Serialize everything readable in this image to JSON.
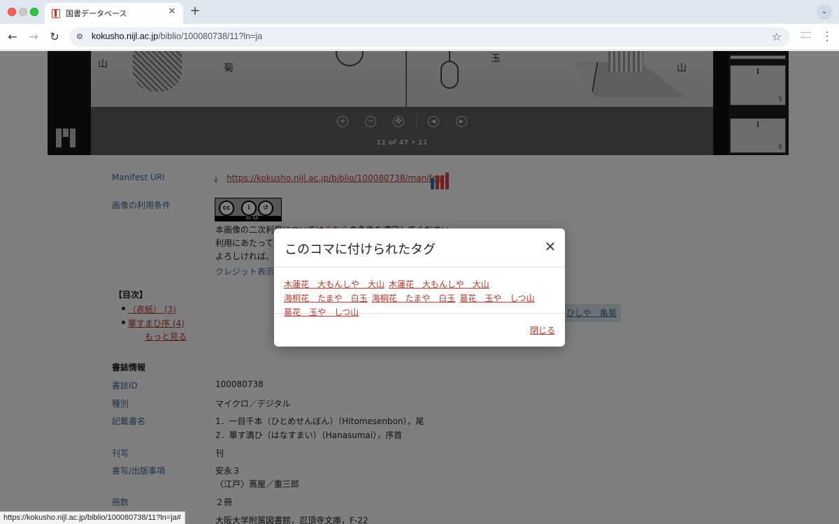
{
  "browser": {
    "tab_title": "国書データベース",
    "tab_close": "✕",
    "new_tab": "+",
    "url_host": "kokusho.nijl.ac.jp",
    "url_path": "/biblio/100080738/11?ln=ja",
    "status_url": "https://kokusho.nijl.ac.jp/biblio/100080738/11?ln=ja#"
  },
  "viewer": {
    "page_indicator": "11 of 47 • 11",
    "controls": [
      "zoom-in",
      "zoom-out",
      "reset",
      "previous",
      "next"
    ],
    "thumbnails": [
      "5",
      "6"
    ]
  },
  "metadata": {
    "manifest_label": "Manifest URI",
    "manifest_url": "https://kokusho.nijl.ac.jp/biblio/100080738/manifest",
    "license_label": "画像の利用条件",
    "license_badge": "BY SA",
    "license_line1_pre": "本画像の二次利用については",
    "license_line1_link": "こちら",
    "license_line1_post": "の条件を遵守してください。",
    "license_line2": "利用にあたって",
    "license_line3": "よろしければ、",
    "credit_link": "クレジット表示",
    "toc_title": "【目次】",
    "toc_items": [
      "（表紙） (3)",
      "華すまひ序 (4)"
    ],
    "toc_more": "もっと見る",
    "toc_hidden_item": "ひしや　亀菊",
    "bib_section": "書誌情報",
    "fields": [
      {
        "label": "書誌ID",
        "value": "100080738"
      },
      {
        "label": "種別",
        "value": "マイクロ／デジタル"
      },
      {
        "label": "記載書名",
        "value": "1．一目千本（ひとめせんぼん）（Hitomesenbon），尾",
        "value2": "2．華す満ひ（はなすまい）（Hanasumai），序首"
      },
      {
        "label": "刊写",
        "value": "刊"
      },
      {
        "label": "書写/出版事項",
        "value": "安永３",
        "value2": "〈江戸〉蔦屋／重三郎"
      },
      {
        "label": "冊数",
        "value": "２冊"
      },
      {
        "label": "",
        "value": "大阪大学附属図書館，忍頂寺文庫，F-22"
      }
    ]
  },
  "modal": {
    "title": "このコマに付けられたタグ",
    "tags": [
      "木蓮花　大もんしや　大山",
      "木蓮花　大もんしや　大山",
      "海桐花　たまや　白玉",
      "海桐花　たまや　白玉",
      "葛花　玉や　しつ山",
      "葛花　玉や　しつ山"
    ],
    "close_label": "閉じる"
  },
  "colors": {
    "link": "#b03a2e",
    "label": "#3d6a9a",
    "backdrop": "rgba(0,0,0,0.5)"
  }
}
